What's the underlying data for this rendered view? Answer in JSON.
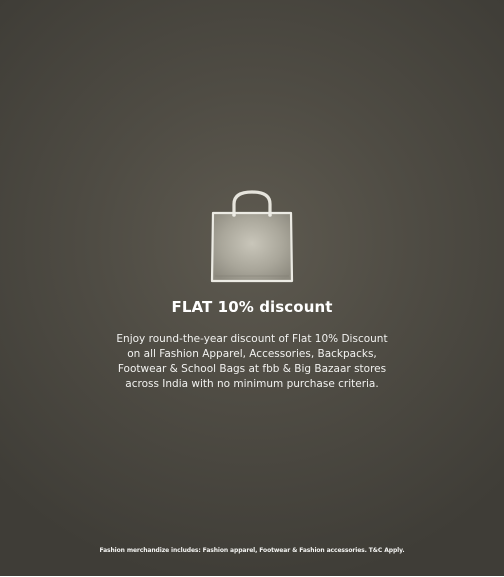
{
  "offer": {
    "icon": "shopping-bag-icon",
    "title": "FLAT 10% discount",
    "description": "Enjoy round-the-year discount of Flat 10% Discount on all Fashion Apparel, Accessories, Backpacks, Footwear & School Bags at fbb & Big Bazaar stores across India with no minimum purchase criteria.",
    "footnote": "Fashion merchandize includes: Fashion apparel, Footwear & Fashion accessories. T&C Apply."
  },
  "colors": {
    "background": "#4f4c44",
    "bag_fill": "#b5b2a6",
    "text": "#ffffff"
  }
}
